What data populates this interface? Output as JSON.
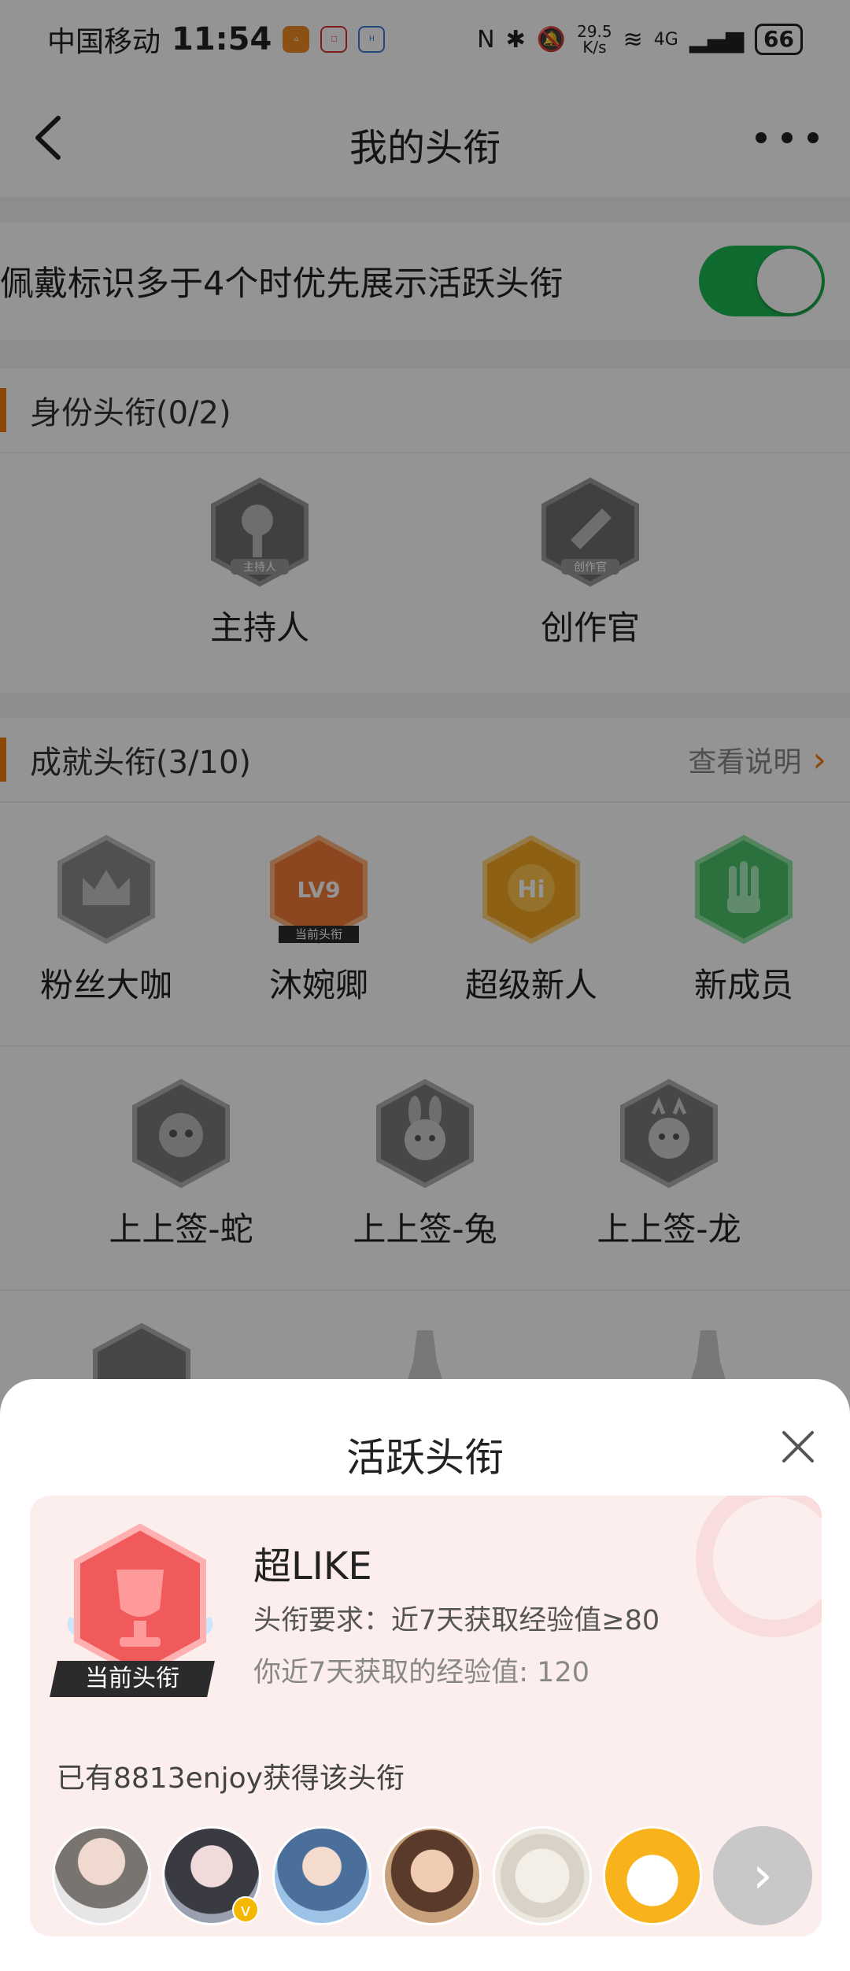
{
  "status_bar": {
    "carrier": "中国移动",
    "time": "11:54",
    "net_speed_value": "29.5",
    "net_speed_unit": "K/s",
    "network": "4G",
    "battery": "66"
  },
  "header": {
    "title": "我的头衔"
  },
  "setting": {
    "label": "佩戴标识多于4个时优先展示活跃头衔",
    "toggle_on": true
  },
  "identity_section": {
    "title": "身份头衔(0/2)",
    "badges": [
      {
        "label": "主持人",
        "icon_text": "主持人",
        "icon": "microphone-icon"
      },
      {
        "label": "创作官",
        "icon_text": "创作官",
        "icon": "pen-icon"
      }
    ]
  },
  "achievement_section": {
    "title": "成就头衔(3/10)",
    "link": "查看说明",
    "row1": [
      {
        "label": "粉丝大咖",
        "icon": "crown-icon",
        "icon_text": ""
      },
      {
        "label": "沐婉卿",
        "icon": "level-icon",
        "icon_text": "LV9",
        "tag": "当前头衔"
      },
      {
        "label": "超级新人",
        "icon": "hi-icon",
        "icon_text": "Hi"
      },
      {
        "label": "新成员",
        "icon": "hand-icon",
        "icon_text": ""
      }
    ],
    "row2": [
      {
        "label": "上上签-蛇",
        "icon": "snake-icon"
      },
      {
        "label": "上上签-兔",
        "icon": "rabbit-icon"
      },
      {
        "label": "上上签-龙",
        "icon": "dragon-icon"
      }
    ]
  },
  "sheet": {
    "title": "活跃头衔",
    "badge_tag": "当前头衔",
    "title_name": "超LIKE",
    "requirement": "头衔要求：近7天获取经验值≥80",
    "experience": "你近7天获取的经验值: 120",
    "holders": "已有8813enjoy获得该头衔"
  },
  "colors": {
    "accent": "#f07d0c",
    "toggle_on": "#1db954",
    "card_bg": "#fdeeee",
    "badge_red": "#f05a5a"
  }
}
